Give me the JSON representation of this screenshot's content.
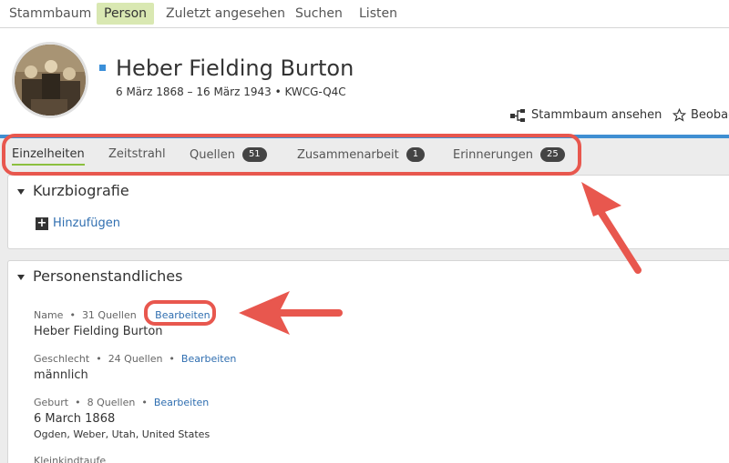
{
  "topnav": {
    "items": [
      "Stammbaum",
      "Person",
      "Zuletzt angesehen",
      "Suchen",
      "Listen"
    ],
    "active": "Person"
  },
  "person": {
    "name": "Heber Fielding Burton",
    "subtitle": "6 März 1868 – 16 März 1943 • KWCG-Q4C"
  },
  "actions": {
    "tree_view": "Stammbaum ansehen",
    "watch": "Beobac"
  },
  "tabs": [
    {
      "label": "Einzelheiten",
      "count": ""
    },
    {
      "label": "Zeitstrahl",
      "count": ""
    },
    {
      "label": "Quellen",
      "count": "51"
    },
    {
      "label": "Zusammenarbeit",
      "count": "1"
    },
    {
      "label": "Erinnerungen",
      "count": "25"
    }
  ],
  "bio": {
    "title": "Kurzbiografie",
    "add_label": "Hinzufügen"
  },
  "vitals": {
    "title": "Personenstandliches",
    "fields": [
      {
        "label": "Name",
        "sources": "31 Quellen",
        "edit": "Bearbeiten",
        "value": "Heber Fielding Burton",
        "place": ""
      },
      {
        "label": "Geschlecht",
        "sources": "24 Quellen",
        "edit": "Bearbeiten",
        "value": "männlich",
        "place": ""
      },
      {
        "label": "Geburt",
        "sources": "8 Quellen",
        "edit": "Bearbeiten",
        "value": "6 March 1868",
        "place": "Ogden, Weber, Utah, United States"
      },
      {
        "label": "Kleinkindtaufe",
        "sources": "",
        "edit": "",
        "value": "",
        "place": ""
      }
    ]
  },
  "annotation_color": "#e8574e",
  "accent_color": "#8bbf3e",
  "link_color": "#2f6eb0"
}
